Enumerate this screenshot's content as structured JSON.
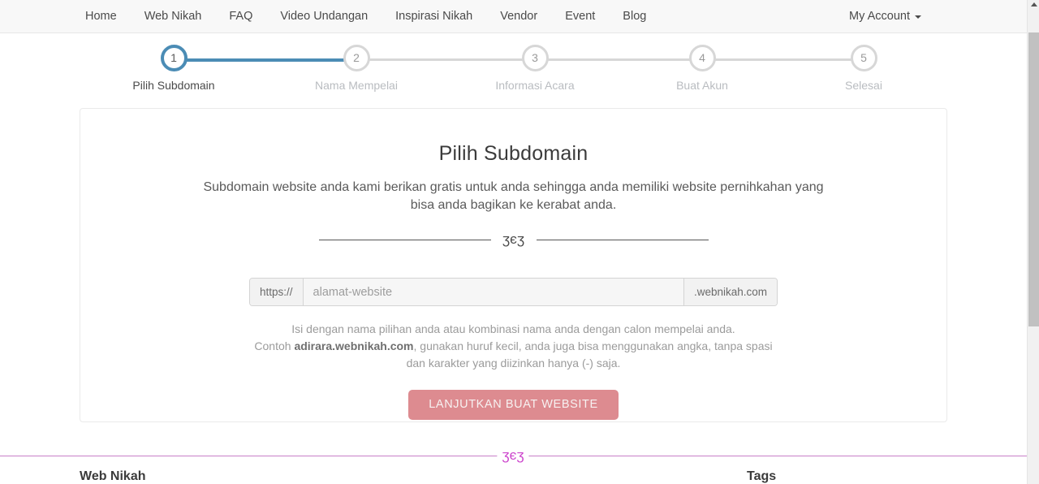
{
  "navbar": {
    "items": [
      {
        "label": "Home",
        "name": "nav-home"
      },
      {
        "label": "Web Nikah",
        "name": "nav-web-nikah"
      },
      {
        "label": "FAQ",
        "name": "nav-faq"
      },
      {
        "label": "Video Undangan",
        "name": "nav-video-undangan"
      },
      {
        "label": "Inspirasi Nikah",
        "name": "nav-inspirasi-nikah"
      },
      {
        "label": "Vendor",
        "name": "nav-vendor"
      },
      {
        "label": "Event",
        "name": "nav-event"
      },
      {
        "label": "Blog",
        "name": "nav-blog"
      }
    ],
    "account_label": "My Account",
    "account_caret_icon": "caret-down-icon"
  },
  "stepper": {
    "active_step": 1,
    "progress_percent": 26,
    "active_color": "#4b8cb5",
    "inactive_color": "#d7d7d7",
    "steps": [
      {
        "number": "1",
        "label": "Pilih Subdomain"
      },
      {
        "number": "2",
        "label": "Nama Mempelai"
      },
      {
        "number": "3",
        "label": "Informasi Acara"
      },
      {
        "number": "4",
        "label": "Buat Akun"
      },
      {
        "number": "5",
        "label": "Selesai"
      }
    ]
  },
  "card": {
    "title": "Pilih Subdomain",
    "subtitle": "Subdomain website anda kami berikan gratis untuk anda sehingga anda memiliki website pernihkahan yang bisa anda bagikan ke kerabat anda.",
    "divider_ornament": "ʒєʒ",
    "input_group": {
      "prefix": "https://",
      "placeholder": "alamat-website",
      "value": "",
      "suffix": ".webnikah.com"
    },
    "help": {
      "line1": "Isi dengan nama pilihan anda atau kombinasi nama anda dengan calon mempelai anda.",
      "line2_prefix": "Contoh ",
      "line2_bold": "adirara.webnikah.com",
      "line2_suffix": ", gunakan huruf kecil, anda juga bisa menggunakan angka, tanpa spasi dan karakter yang diizinkan hanya (-) saja."
    },
    "cta_label": "LANJUTKAN BUAT WEBSITE",
    "cta_color": "#dd8b90"
  },
  "footer": {
    "divider_color": "#c77fc7",
    "ornament": "ʒєʒ",
    "col1_title": "Web Nikah",
    "col2_title": "Tags"
  },
  "scrollbar": {
    "up_arrow_icon": "scroll-up-arrow-icon",
    "thumb_icon": "scrollbar-thumb"
  }
}
